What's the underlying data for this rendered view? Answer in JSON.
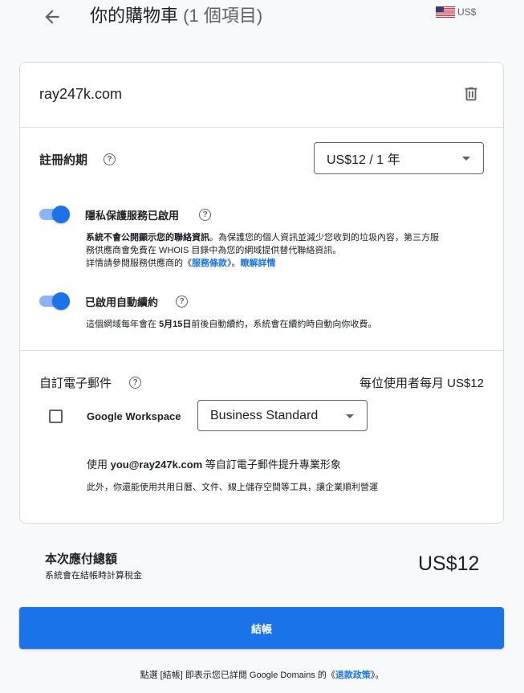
{
  "header": {
    "title": "你的購物車",
    "item_count": "(1 個項目)",
    "currency": "US$"
  },
  "cart": {
    "domain": "ray247k.com",
    "registration": {
      "label": "註冊約期",
      "selected": "US$12 / 1 年"
    },
    "privacy": {
      "label": "隱私保護服務已啟用",
      "enabled": true,
      "desc_bold": "系統不會公開顯示您的聯絡資訊",
      "desc_part1": "。為保護您的個人資訊並減少您收到的垃圾內容，第三方服務供應商會免費在 WHOIS 目錄中為您的網域提供替代聯絡資訊。",
      "desc_part2": "詳情請參閱服務供應商的《",
      "terms_link": "服務條款",
      "desc_part3": "》。",
      "learn_more": "瞭解詳情"
    },
    "auto_renew": {
      "label": "已啟用自動續約",
      "enabled": true,
      "desc_part1": "這個網域每年會在 ",
      "date": "5月15日",
      "desc_part2": "前後自動續約，系統會在續約時自動向你收費。"
    },
    "email": {
      "label": "自訂電子郵件",
      "price_note": "每位使用者每月 US$12",
      "product": "Google Workspace",
      "plan_selected": "Business Standard",
      "promo_part1": "使用 ",
      "promo_email": "you@ray247k.com",
      "promo_part2": " 等自訂電子郵件提升專業形象",
      "promo_desc": "此外，你還能使用共用日曆、文件、線上儲存空間等工具，讓企業順利營運"
    }
  },
  "total": {
    "label": "本次應付總額",
    "sub": "系統會在結帳時計算稅金",
    "price": "US$12"
  },
  "checkout": {
    "button": "結帳"
  },
  "footer": {
    "part1": "點選 [結帳] 即表示您已詳閱 Google Domains 的《",
    "refund_link": "退款政策",
    "part2": "》。"
  },
  "colors": {
    "accent": "#1a73e8",
    "toggle_track": "#8ab4f8",
    "border": "#dadce0"
  }
}
